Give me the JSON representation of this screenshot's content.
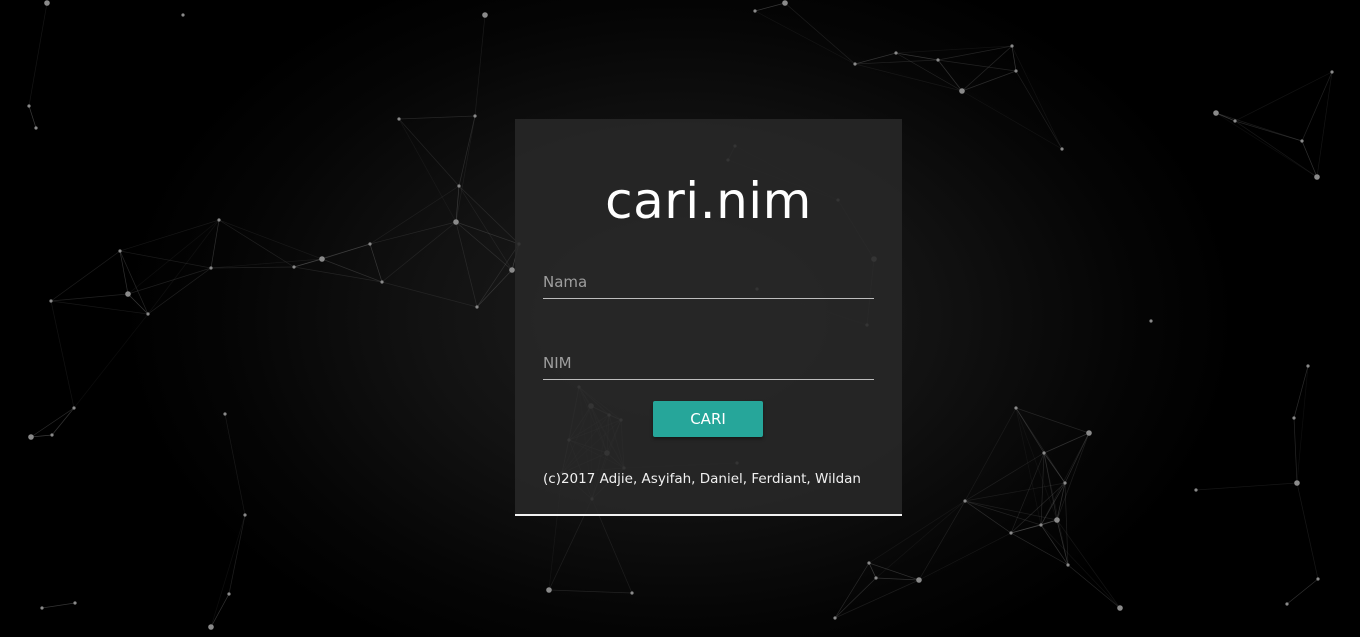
{
  "app": {
    "title": "cari.nim"
  },
  "form": {
    "nama_placeholder": "Nama",
    "nama_value": "",
    "nim_placeholder": "NIM",
    "nim_value": "",
    "submit_label": "CARI"
  },
  "footer": {
    "credit": "(c)2017 Adjie, Asyifah, Daniel, Ferdiant, Wildan"
  },
  "theme": {
    "background": "#000000",
    "card": "#282828",
    "accent": "#26a69a",
    "network_line": "#5a5a5a",
    "network_dot": "#8a8a8a"
  }
}
